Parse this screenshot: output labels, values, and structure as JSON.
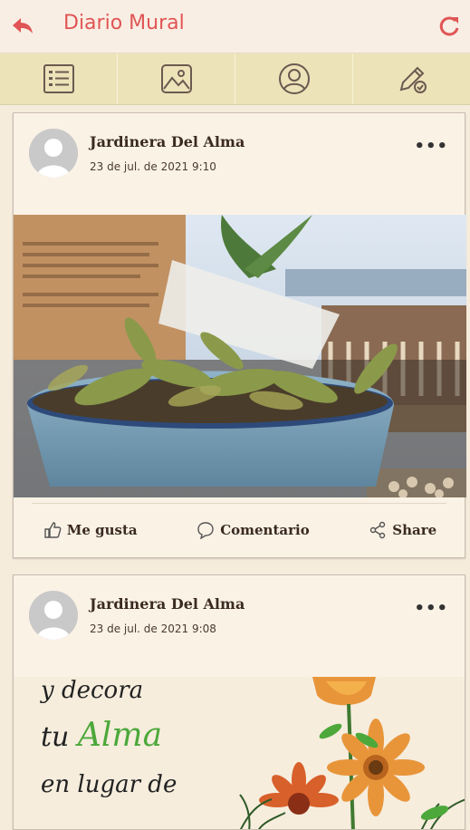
{
  "header": {
    "title": "Diario Mural"
  },
  "tabs": [
    {
      "name": "list-tab",
      "icon": "list-icon"
    },
    {
      "name": "gallery-tab",
      "icon": "image-icon"
    },
    {
      "name": "profile-tab",
      "icon": "user-icon"
    },
    {
      "name": "edit-tab",
      "icon": "edit-icon"
    }
  ],
  "posts": [
    {
      "author": "Jardinera Del Alma",
      "date": "23 de jul. de 2021 9:10",
      "actions": {
        "like": "Me gusta",
        "comment": "Comentario",
        "share": "Share"
      }
    },
    {
      "author": "Jardinera Del Alma",
      "date": "23 de jul. de 2021 9:08",
      "poster": {
        "line1": "y decora",
        "line2_prefix": "tu ",
        "line2_word": "Alma",
        "line3": "en lugar de"
      }
    }
  ],
  "colors": {
    "accent": "#e05555",
    "tabs_bg": "#ece3b9",
    "green": "#4ca83a"
  }
}
